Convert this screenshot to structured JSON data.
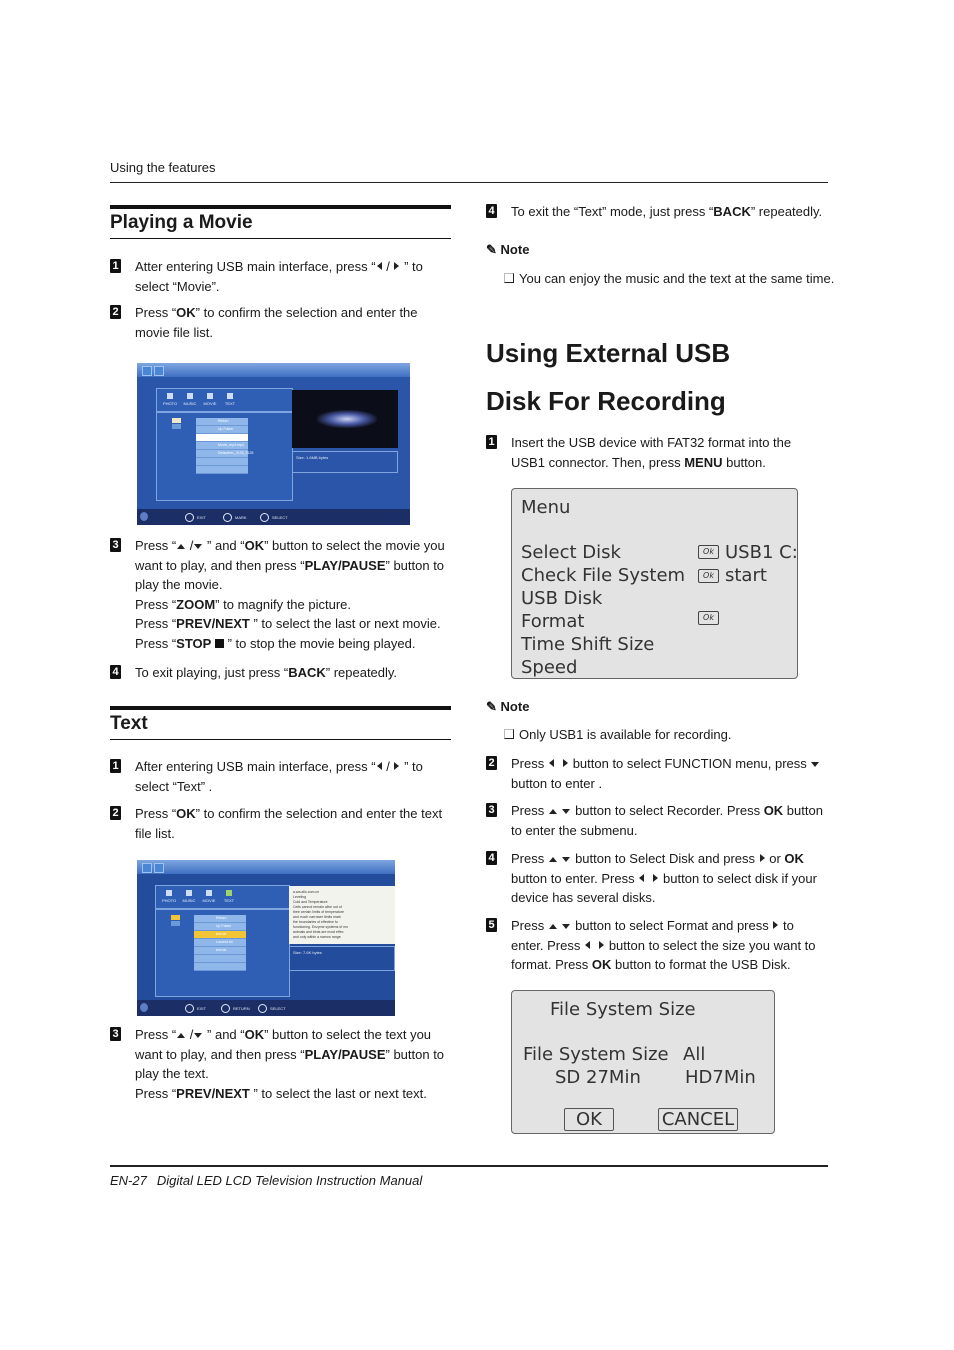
{
  "header": {
    "running_head": "Using the features"
  },
  "footer": {
    "page": "EN-27",
    "title": "Digital LED LCD Television Instruction Manual"
  },
  "playing_movie": {
    "title": "Playing a Movie",
    "steps": [
      {
        "num": "1",
        "a": "Atter entering USB main interface, press “",
        "b": " / ",
        "c": " ” to select “Movie”."
      },
      {
        "num": "2",
        "a": "Press “",
        "bold": "OK",
        "c": "” to confirm the selection and enter the movie file list."
      },
      {
        "num": "3",
        "l1a": "Press “",
        "l1b": " /",
        "l1c": " ” and “",
        "l1bold": "OK",
        "l1d": "” button to select the movie you want to play, and then press “",
        "l1bold2": "PLAY/PAUSE",
        "l1e": "” button to play the movie.",
        "l2a": "Press “",
        "l2bold": "ZOOM",
        "l2b": "” to magnify the picture.",
        "l3a": "Press “",
        "l3bold": "PREV/NEXT",
        "l3b": " ” to select the last or next movie.",
        "l4a": "Press “",
        "l4bold": "STOP",
        "l4b": " ” to stop the movie being played."
      },
      {
        "num": "4",
        "a": "To exit playing, just press “",
        "bold": "BACK",
        "c": "” repeatedly."
      }
    ],
    "screen": {
      "tabs": [
        "PHOTO",
        "MUSIC",
        "MOVIE",
        "TEXT"
      ],
      "rows": [
        "Return",
        "Up Folder",
        "",
        "Movie_mp4.mp4",
        "Defaultrec_0130_0125"
      ],
      "info": "Size:   1.6MB bytes",
      "buttons": [
        "EXIT",
        "MARK",
        "SELECT"
      ]
    }
  },
  "text_section": {
    "title": "Text",
    "steps": [
      {
        "num": "1",
        "a": "After entering USB main interface, press “",
        "b": " / ",
        "c": " ” to select “Text” ."
      },
      {
        "num": "2",
        "a": "Press “",
        "bold": "OK",
        "c": "” to confirm the selection and enter the text file list."
      },
      {
        "num": "3",
        "l1a": "Press “",
        "l1b": " /",
        "l1c": " ” and “",
        "l1bold": "OK",
        "l1d": "” button to select the text you want to play, and then press “",
        "l1bold2": "PLAY/PAUSE",
        "l1e": "” button to play the text.",
        "l2a": "Press “",
        "l2bold": "PREV/NEXT",
        "l2b": " ” to select the last or next text."
      },
      {
        "num": "4",
        "a": "To exit the “Text” mode, just press “",
        "bold": "BACK",
        "c": "” repeatedly."
      }
    ],
    "screen": {
      "tabs": [
        "PHOTO",
        "MUSIC",
        "MOVIE",
        "TEXT"
      ],
      "rows": [
        "Return",
        "Up Folder",
        "text.txt",
        "Laurent.txt",
        "text.txt"
      ],
      "text_lines": [
        "a.wa.allo.com.cn",
        "Leveling",
        "Cold and Temperature",
        "Cells cannot remain alive out of",
        "their certain limits of temperature",
        "and much narrower limits mark",
        "the boundaries of effective fu",
        "functioning. Enzyme systems of mo",
        "animals and birds are most effec",
        "and only within a narrow range"
      ],
      "info": "Size:   7.6K bytes",
      "buttons": [
        "EXIT",
        "RETURN",
        "SELECT"
      ]
    },
    "note": {
      "label": "Note",
      "items": [
        "You can enjoy the music and the text at the same time."
      ]
    }
  },
  "recording": {
    "title_line1": "Using External USB",
    "title_line2": "Disk For Recording",
    "step1": {
      "num": "1",
      "a": "Insert the USB device with FAT32 format into the USB1 connector. Then, press ",
      "bold": "MENU",
      "c": " button."
    },
    "menu": {
      "title": "Menu",
      "items": [
        "Select  Disk",
        "Check File System",
        "USB Disk",
        "Format",
        "Time Shift Size",
        "Speed"
      ],
      "ok_label": "Ok",
      "values": {
        "select_disk": "USB1 C:",
        "check_fs": "start"
      }
    },
    "note": {
      "label": "Note",
      "items": [
        "Only USB1 is available for recording."
      ]
    },
    "step2": {
      "num": "2",
      "a": "Press ",
      "b": " button to select FUNCTION menu, press ",
      "c": " button to enter ."
    },
    "step3": {
      "num": "3",
      "a": "Press ",
      "b": " button to select Recorder. Press ",
      "bold": "OK",
      "c": " button to enter the submenu."
    },
    "step4": {
      "num": "4",
      "a": "Press ",
      "b": " button to Select Disk and press ",
      "c": " or ",
      "bold": "OK",
      "d": " button to enter. Press ",
      "e": " button to select disk if your device has several disks."
    },
    "step5": {
      "num": "5",
      "a": "Press ",
      "b": " button to select Format and press ",
      "c": " to enter. Press ",
      "d": " button to select the size you want to format. Press ",
      "bold": "OK",
      "e": " button to format the USB Disk."
    },
    "fs_dialog": {
      "title": "File System Size",
      "row1_label": "File System Size",
      "row1_value": "All",
      "row2_sd": "SD 27Min",
      "row2_hd": "HD7Min",
      "ok": "OK",
      "cancel": "CANCEL"
    }
  }
}
